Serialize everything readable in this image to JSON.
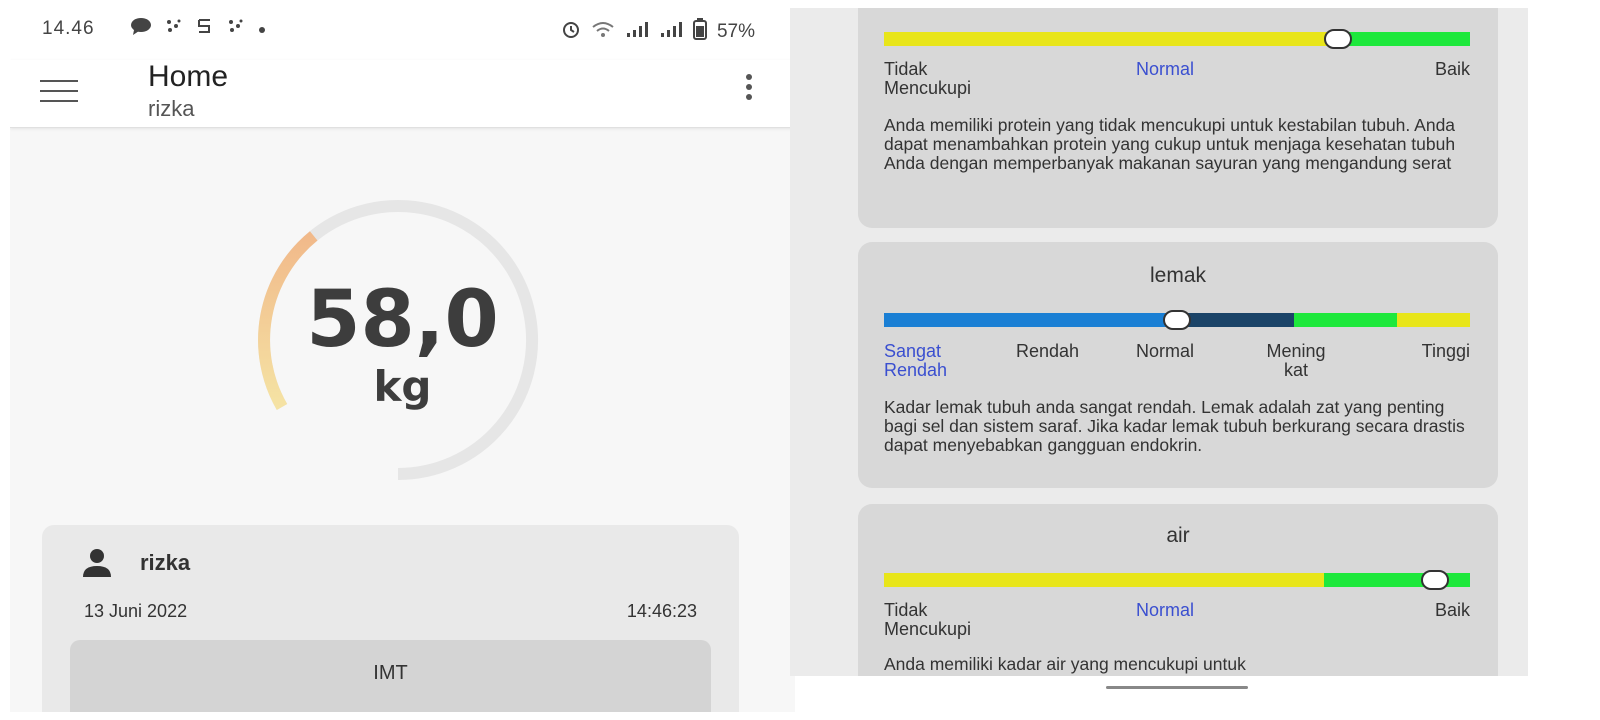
{
  "status_bar": {
    "time": "14.46",
    "battery_percent": "57%",
    "left_icons": [
      "chat-icon",
      "dots-icon",
      "s-icon",
      "dots-icon",
      "dot-icon"
    ],
    "right_icons": [
      "alarm-icon",
      "wifi-icon",
      "signal-icon",
      "signal-icon",
      "battery-icon"
    ]
  },
  "app_bar": {
    "title": "Home",
    "subtitle": "rizka"
  },
  "gauge": {
    "value": "58,0",
    "unit": "kg",
    "arc_fraction": 0.27,
    "colors": {
      "track": "#e6e6e6",
      "fill_start": "#f1b98a",
      "fill_end": "#f5e3a4"
    }
  },
  "user_card": {
    "name": "rizka",
    "date": "13 Juni 2022",
    "time": "14:46:23",
    "button_label": "IMT"
  },
  "panels": {
    "protein": {
      "segments": [
        {
          "color": "#e8e51a",
          "fraction": 0.78
        },
        {
          "color": "#1ee83c",
          "fraction": 0.22
        }
      ],
      "indicator_fraction": 0.775,
      "labels": [
        "Tidak\nMencukupi",
        "Normal",
        "Baik"
      ],
      "active_label": "Normal",
      "description": "Anda memiliki protein yang tidak mencukupi untuk kestabilan tubuh. Anda dapat menambahkan protein yang cukup untuk menjaga kesehatan tubuh Anda dengan memperbanyak makanan sayuran yang mengandung serat"
    },
    "lemak": {
      "title": "lemak",
      "segments": [
        {
          "color": "#1a7fd4",
          "fraction": 0.5
        },
        {
          "color": "#1b4468",
          "fraction": 0.2
        },
        {
          "color": "#1ee83c",
          "fraction": 0.175
        },
        {
          "color": "#e8e51a",
          "fraction": 0.125
        }
      ],
      "indicator_fraction": 0.5,
      "labels": [
        "Sangat\nRendah",
        "Rendah",
        "Normal",
        "Mening\nkat",
        "Tinggi"
      ],
      "active_label": "Sangat Rendah",
      "description": "Kadar lemak tubuh anda sangat rendah. Lemak adalah zat yang penting bagi sel dan sistem saraf. Jika kadar lemak tubuh berkurang secara drastis dapat menyebabkan gangguan endokrin."
    },
    "air": {
      "title": "air",
      "segments": [
        {
          "color": "#e8e51a",
          "fraction": 0.75
        },
        {
          "color": "#1ee83c",
          "fraction": 0.25
        }
      ],
      "indicator_fraction": 0.94,
      "labels": [
        "Tidak\nMencukupi",
        "Normal",
        "Baik"
      ],
      "active_label": "Normal",
      "description": "Anda memiliki kadar air yang mencukupi untuk"
    }
  }
}
